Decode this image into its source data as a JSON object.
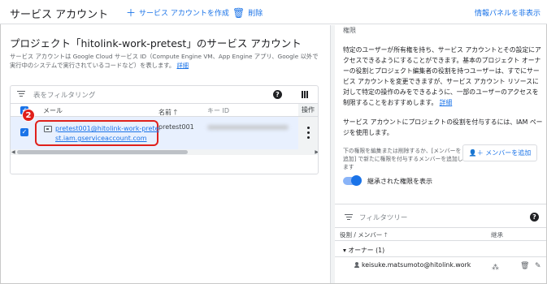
{
  "header": {
    "title": "サービス アカウント",
    "create_label": "サービス アカウントを作成",
    "delete_label": "削除",
    "hide_panel_label": "情報パネルを非表示"
  },
  "main": {
    "project_title": "プロジェクト「hitolink-work-pretest」のサービス アカウント",
    "description": "サービス アカウントは Google Cloud サービス ID（Compute Engine VM、App Engine アプリ、Google 以外で実行中のシステムで実行されているコードなど）を表します。",
    "description_link": "詳細",
    "filter_placeholder": "表をフィルタリング",
    "columns": {
      "email": "メール",
      "name": "名前",
      "key_id": "キー ID",
      "actions": "操作"
    },
    "rows": [
      {
        "email": "pretest001@hitolink-work-pretest.iam.gserviceaccount.com",
        "name": "pretest001",
        "selected": true
      }
    ],
    "callout_number": "2"
  },
  "panel": {
    "section_title": "権限",
    "info_text": "特定のユーザーが所有権を持ち、サービス アカウントとその設定にアクセスできるようにすることができます。基本のプロジェクト オーナーの役割とプロジェクト編集者の役割を持つユーザーは、すでにサービス アカウントを変更できますが、サービス アカウント リソースに対して特定の操作のみをできるように、一部のユーザーのアクセスを制限することをおすすめします。",
    "info_link": "詳細",
    "grant_text": "サービス アカウントにプロジェクトの役割を付与するには、IAM ページを使用します。",
    "edit_note": "下の権限を編集または削除するか、[メンバーを追加] で新たに権限を付与するメンバーを追加します",
    "add_member_label": "メンバーを追加",
    "inherited_toggle_label": "継承された権限を表示",
    "filter_tree_placeholder": "フィルタツリー",
    "tree_col_role": "役割 / メンバー",
    "tree_col_inherit": "継承",
    "owner_group": "オーナー (1)",
    "member": "keisuke.matsumoto@hitolink.work"
  },
  "colors": {
    "accent": "#1a73e8",
    "callout": "#e0201b",
    "selected_row": "#e8f0fe"
  }
}
